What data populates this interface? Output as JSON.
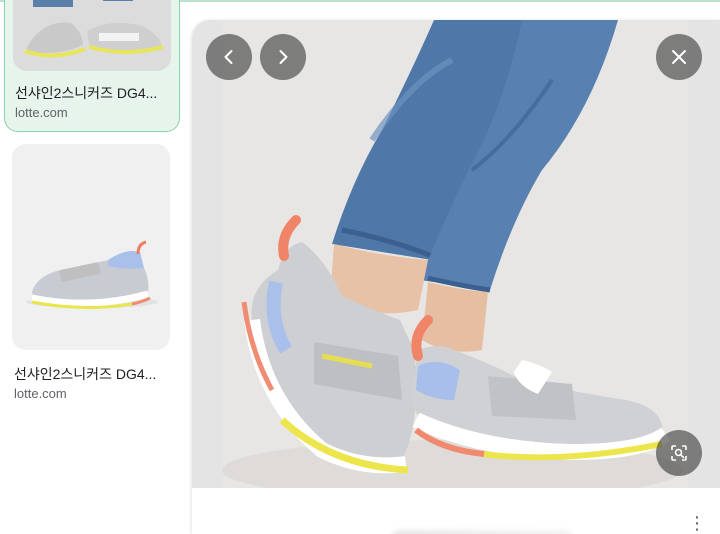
{
  "results": [
    {
      "title": "선샤인2스니커즈 DG4...",
      "source": "lotte.com",
      "selected": true
    },
    {
      "title": "선샤인2스니커즈 DG4...",
      "source": "lotte.com",
      "selected": false
    }
  ],
  "viewer": {
    "prev_icon": "chevron-left-icon",
    "next_icon": "chevron-right-icon",
    "close_icon": "close-icon",
    "lens_icon": "image-search-icon",
    "more_icon": "more-vert-icon",
    "more_glyph": "⋮",
    "image_subject": "sneaker-on-feet-photo"
  },
  "colors": {
    "selected_bg": "#e6f4ec",
    "selected_border": "#8fd0ad",
    "overlay_button": "#3c3c3c"
  }
}
